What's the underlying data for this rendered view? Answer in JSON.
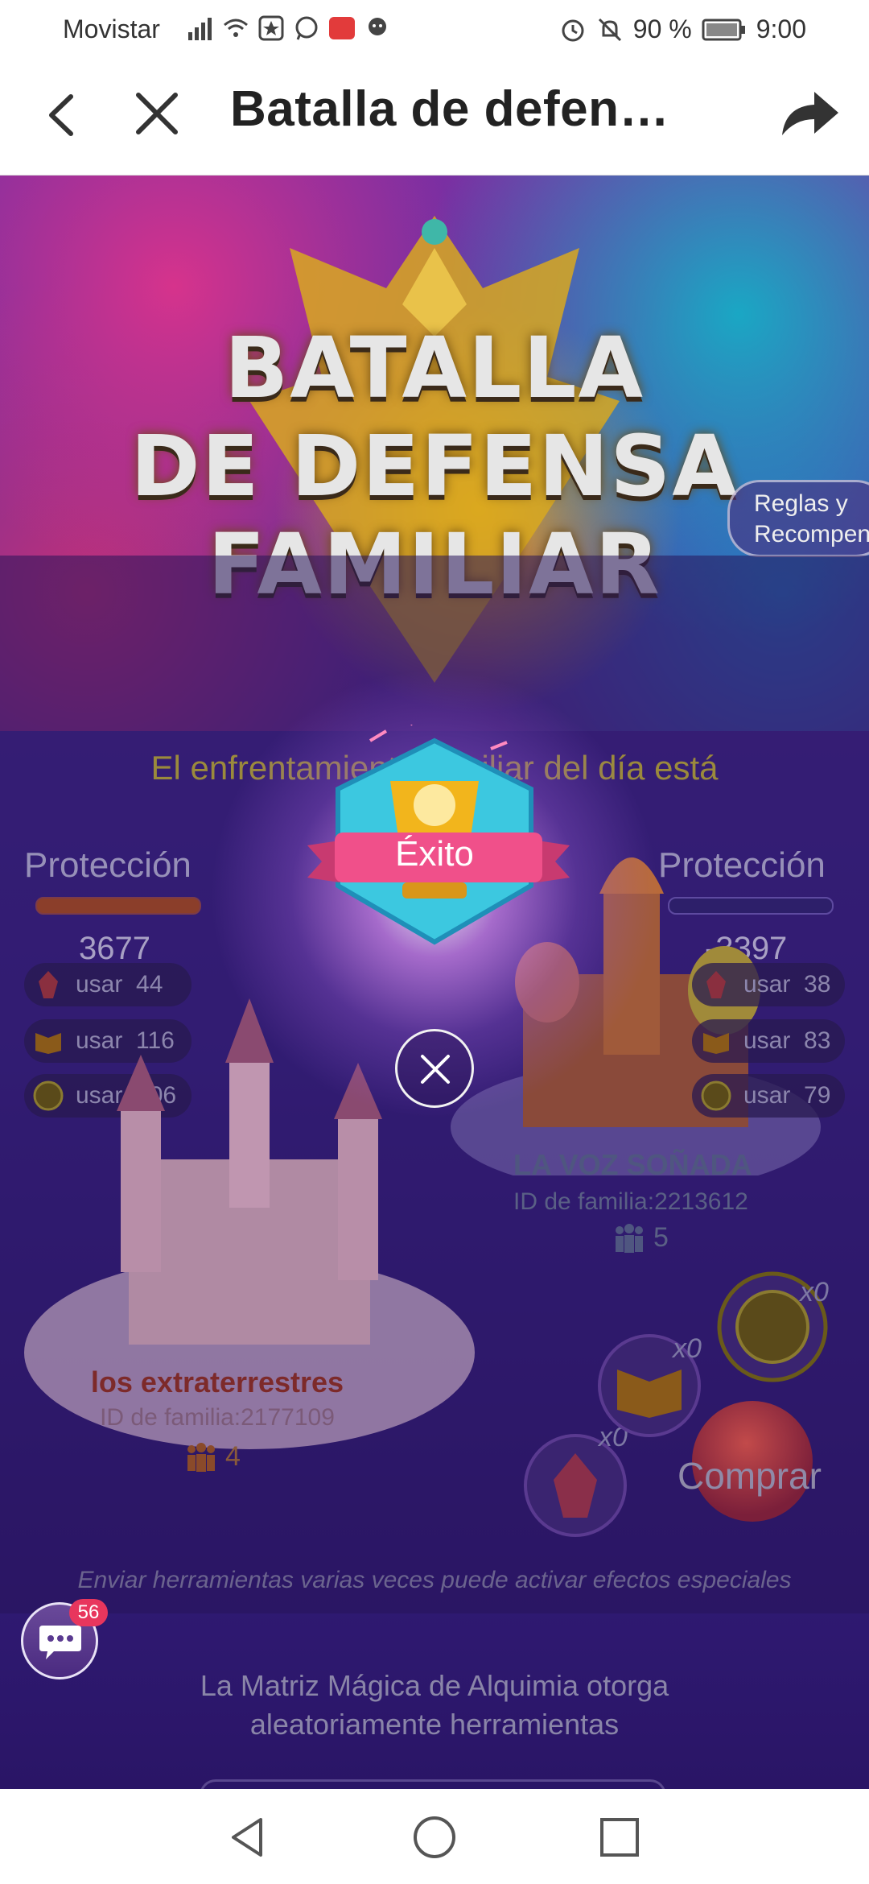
{
  "status_bar": {
    "carrier": "Movistar",
    "battery": "90 %",
    "time": "9:00",
    "icons": [
      "signal-icon",
      "wifi-icon",
      "star-app-icon",
      "whatsapp-icon",
      "huawei-icon",
      "messenger-icon",
      "alarm-icon",
      "mute-icon",
      "battery-icon"
    ]
  },
  "header": {
    "title": "Batalla de defen…",
    "back_icon": "chevron-left-icon",
    "close_icon": "close-icon",
    "share_icon": "share-icon"
  },
  "banner": {
    "title_lines": [
      "BATALLA",
      "DE DEFENSA",
      "FAMILIAR"
    ],
    "rules_button": "Reglas y Recompensa"
  },
  "battle": {
    "headline": "El enfrentamiento familiar del día está",
    "left": {
      "protection_label": "Protección",
      "score": "3677",
      "tools": [
        {
          "icon": "crystal-icon",
          "text": "usar  44"
        },
        {
          "icon": "book-icon",
          "text": "usar  116"
        },
        {
          "icon": "orb-icon",
          "text": "usar  106"
        }
      ],
      "team_name": "los extraterrestres",
      "family_id": "ID de familia:2177109",
      "members": "4"
    },
    "right": {
      "protection_label": "Protección",
      "score": "-3397",
      "tools": [
        {
          "icon": "crystal-icon",
          "text": "usar  38"
        },
        {
          "icon": "book-icon",
          "text": "usar  83"
        },
        {
          "icon": "orb-icon",
          "text": "usar  79"
        }
      ],
      "team_name": "LA VOZ SOÑADA",
      "family_id": "ID de familia:2213612",
      "members": "5"
    }
  },
  "shop": {
    "counts": [
      "x0",
      "x0",
      "x0"
    ],
    "buy_label": "Comprar"
  },
  "hint": "Enviar herramientas varias veces puede activar efectos especiales",
  "alchemy": {
    "line1": "La Matriz Mágica de Alquimia otorga",
    "line2": "aleatoriamente herramientas"
  },
  "chat": {
    "badge": "56"
  },
  "modal": {
    "title": "Éxito"
  },
  "colors": {
    "accent_pink": "#e8365d",
    "modal_ribbon": "#f0508a",
    "background_purple": "#3d2690"
  }
}
